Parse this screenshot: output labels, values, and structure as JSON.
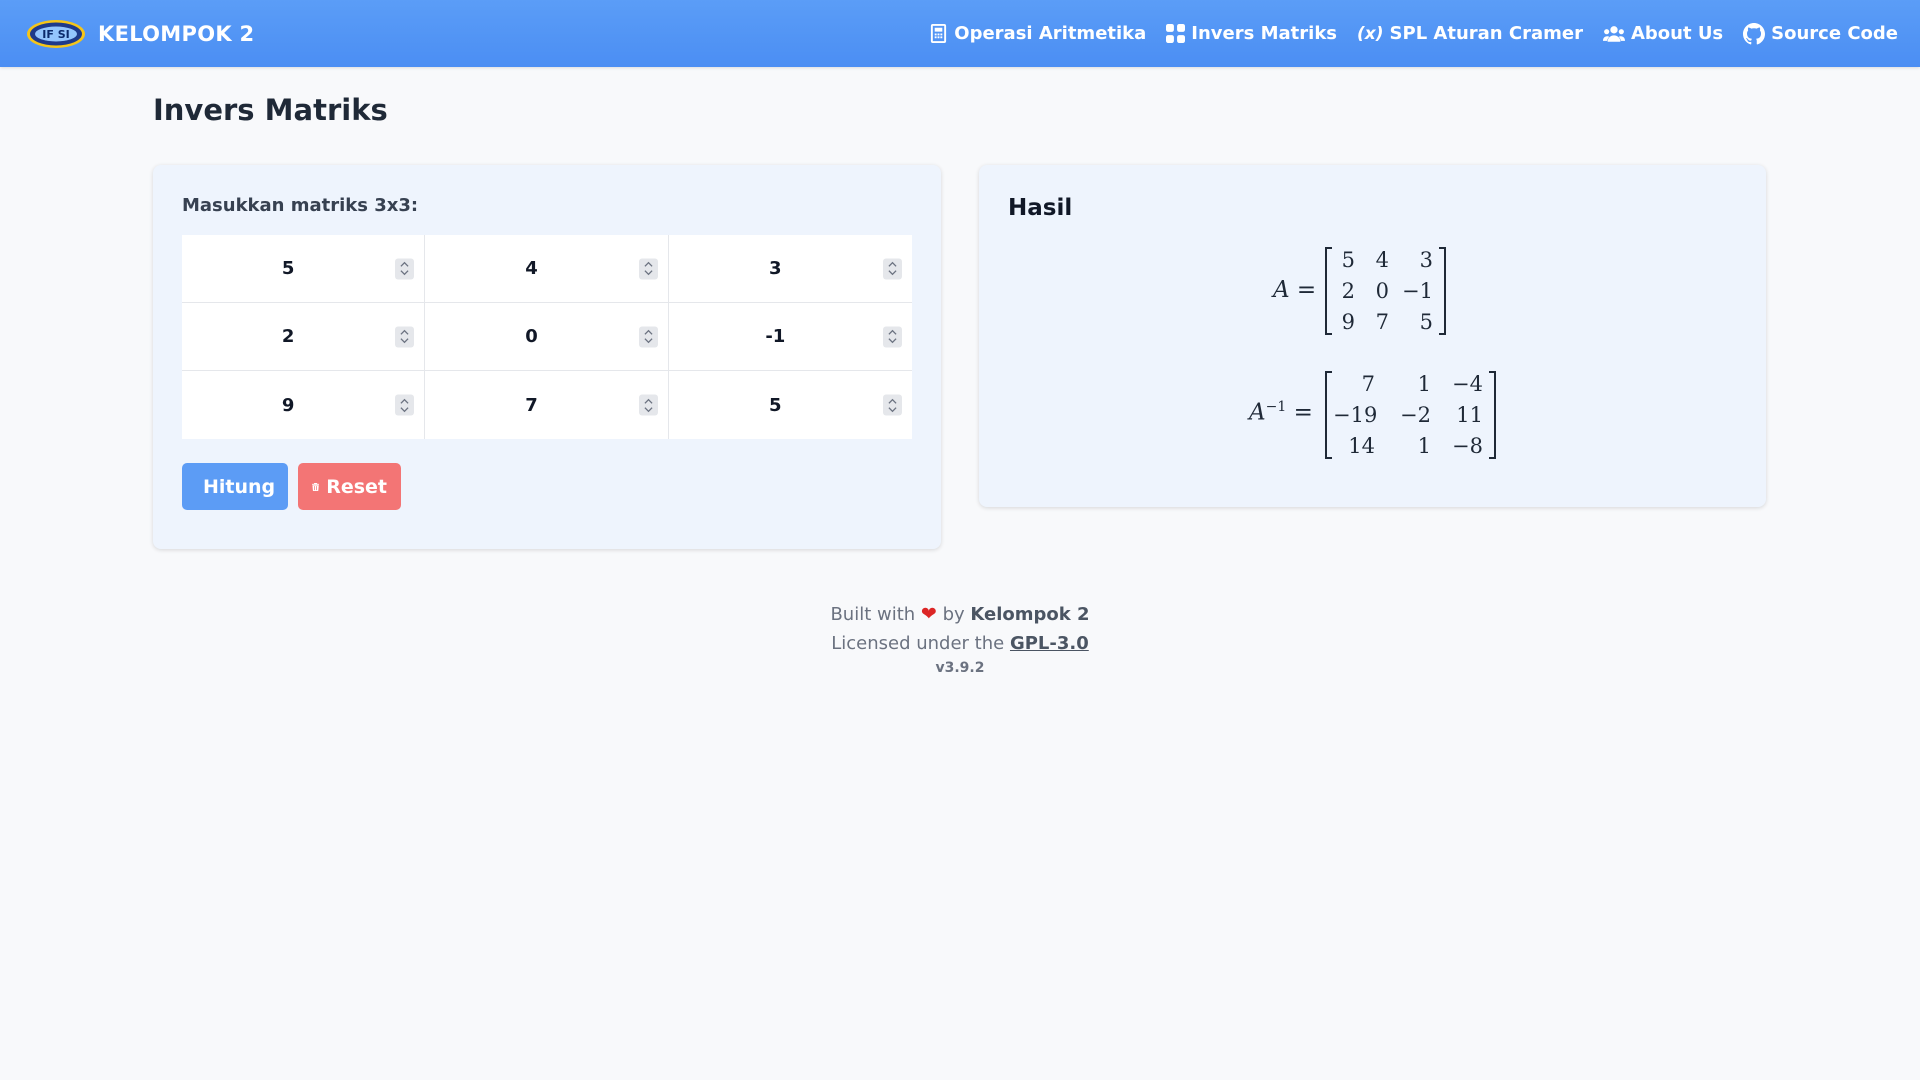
{
  "navbar": {
    "brand": "KELOMPOK 2",
    "logo_text": "IF SI",
    "links": [
      {
        "label": "Operasi Aritmetika",
        "icon": "calculator-icon"
      },
      {
        "label": "Invers Matriks",
        "icon": "grid-icon"
      },
      {
        "label": "SPL Aturan Cramer",
        "icon": "function-icon",
        "icon_text": "(x)"
      },
      {
        "label": "About Us",
        "icon": "users-icon"
      },
      {
        "label": "Source Code",
        "icon": "github-icon"
      }
    ]
  },
  "page": {
    "title": "Invers Matriks"
  },
  "input_card": {
    "label": "Masukkan matriks 3x3:",
    "matrix": [
      [
        "5",
        "4",
        "3"
      ],
      [
        "2",
        "0",
        "-1"
      ],
      [
        "9",
        "7",
        "5"
      ]
    ],
    "buttons": {
      "compute": "Hitung",
      "reset": "Reset"
    }
  },
  "result_card": {
    "title": "Hasil",
    "matrix_label": "A =",
    "inverse_label": "A",
    "inverse_sup": "−1",
    "inverse_eq": " =",
    "matrix": [
      [
        "5",
        "4",
        "3"
      ],
      [
        "2",
        "0",
        "−1"
      ],
      [
        "9",
        "7",
        "5"
      ]
    ],
    "inverse": [
      [
        "7",
        "1",
        "−4"
      ],
      [
        "−19",
        "−2",
        "11"
      ],
      [
        "14",
        "1",
        "−8"
      ]
    ]
  },
  "footer": {
    "built_prefix": "Built with",
    "built_by": "by",
    "author": "Kelompok 2",
    "license_prefix": "Licensed under the",
    "license": "GPL-3.0",
    "version": "v3.9.2"
  },
  "colors": {
    "navbar": "#4b8ef3",
    "compute_button": "#5c9cf5",
    "reset_button": "#f37575",
    "card_bg": "#eef4fd",
    "heart": "#dc2626"
  }
}
